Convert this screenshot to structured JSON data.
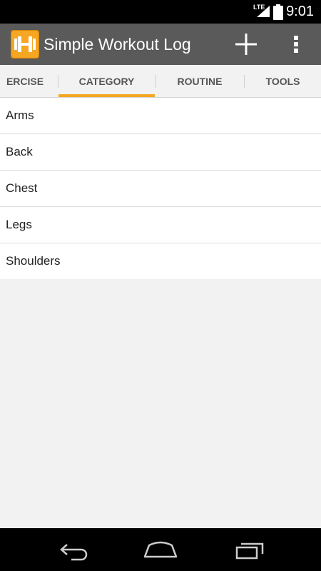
{
  "status": {
    "network": "LTE",
    "time": "9:01"
  },
  "app": {
    "title": "Simple Workout Log",
    "accent": "#f5a623",
    "bar_color": "#5a5a5a"
  },
  "actions": {
    "add_icon": "plus-icon",
    "overflow_icon": "more-vert-icon"
  },
  "tabs": [
    {
      "label": "ERCISE",
      "selected": false
    },
    {
      "label": "CATEGORY",
      "selected": true
    },
    {
      "label": "ROUTINE",
      "selected": false
    },
    {
      "label": "TOOLS",
      "selected": false
    }
  ],
  "categories": [
    {
      "label": "Arms"
    },
    {
      "label": "Back"
    },
    {
      "label": "Chest"
    },
    {
      "label": "Legs"
    },
    {
      "label": "Shoulders"
    }
  ],
  "nav": {
    "back_icon": "back-icon",
    "home_icon": "home-icon",
    "recents_icon": "recents-icon"
  }
}
